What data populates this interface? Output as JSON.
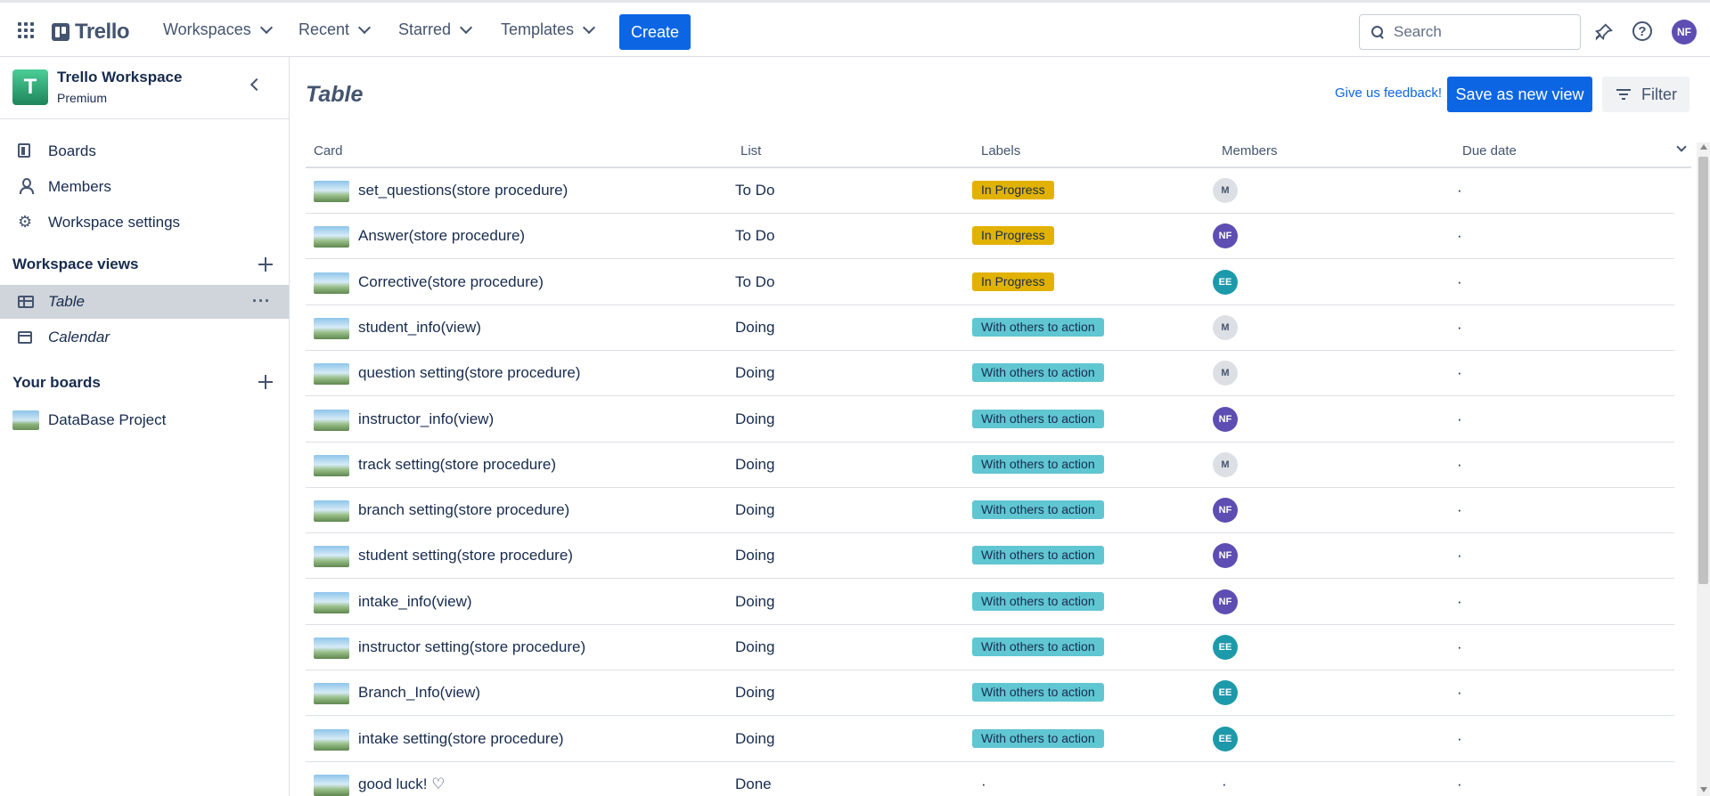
{
  "header": {
    "app_name": "Trello",
    "nav": [
      "Workspaces",
      "Recent",
      "Starred",
      "Templates"
    ],
    "create_label": "Create",
    "search_placeholder": "Search",
    "user_initials": "NF",
    "notification_icon": "notification-icon",
    "help_icon": "help-icon"
  },
  "sidebar": {
    "workspace_initial": "T",
    "workspace_name": "Trello Workspace",
    "workspace_plan": "Premium",
    "items": [
      {
        "label": "Boards",
        "icon": "board-icon"
      },
      {
        "label": "Members",
        "icon": "member-icon"
      },
      {
        "label": "Workspace settings",
        "icon": "gear-icon"
      }
    ],
    "views_title": "Workspace views",
    "views": [
      {
        "label": "Table",
        "icon": "table-icon",
        "active": true
      },
      {
        "label": "Calendar",
        "icon": "calendar-icon",
        "active": false
      }
    ],
    "boards_title": "Your boards",
    "boards": [
      {
        "label": "DataBase Project"
      }
    ]
  },
  "main": {
    "title": "Table",
    "feedback_label": "Give us feedback!",
    "save_label": "Save as new view",
    "filter_label": "Filter",
    "columns": [
      "Card",
      "List",
      "Labels",
      "Members",
      "Due date"
    ],
    "rows": [
      {
        "card": "set_questions(store procedure)",
        "list": "To Do",
        "label": "In Progress",
        "label_color": "#e2b203",
        "member": "M",
        "due": "·"
      },
      {
        "card": "Answer(store procedure)",
        "list": "To Do",
        "label": "In Progress",
        "label_color": "#e2b203",
        "member": "NF",
        "due": "·"
      },
      {
        "card": "Corrective(store procedure)",
        "list": "To Do",
        "label": "In Progress",
        "label_color": "#e2b203",
        "member": "EE",
        "due": "·"
      },
      {
        "card": "student_info(view)",
        "list": "Doing",
        "label": "With others to action",
        "label_color": "#60c6d2",
        "member": "M",
        "due": "·"
      },
      {
        "card": "question setting(store procedure)",
        "list": "Doing",
        "label": "With others to action",
        "label_color": "#60c6d2",
        "member": "M",
        "due": "·"
      },
      {
        "card": "instructor_info(view)",
        "list": "Doing",
        "label": "With others to action",
        "label_color": "#60c6d2",
        "member": "NF",
        "due": "·"
      },
      {
        "card": "track setting(store procedure)",
        "list": "Doing",
        "label": "With others to action",
        "label_color": "#60c6d2",
        "member": "M",
        "due": "·"
      },
      {
        "card": "branch setting(store procedure)",
        "list": "Doing",
        "label": "With others to action",
        "label_color": "#60c6d2",
        "member": "NF",
        "due": "·"
      },
      {
        "card": "student setting(store procedure)",
        "list": "Doing",
        "label": "With others to action",
        "label_color": "#60c6d2",
        "member": "NF",
        "due": "·"
      },
      {
        "card": "intake_info(view)",
        "list": "Doing",
        "label": "With others to action",
        "label_color": "#60c6d2",
        "member": "NF",
        "due": "·"
      },
      {
        "card": "instructor setting(store procedure)",
        "list": "Doing",
        "label": "With others to action",
        "label_color": "#60c6d2",
        "member": "EE",
        "due": "·"
      },
      {
        "card": "Branch_Info(view)",
        "list": "Doing",
        "label": "With others to action",
        "label_color": "#60c6d2",
        "member": "EE",
        "due": "·"
      },
      {
        "card": "intake setting(store procedure)",
        "list": "Doing",
        "label": "With others to action",
        "label_color": "#60c6d2",
        "member": "EE",
        "due": "·"
      },
      {
        "card": "good luck! ♡",
        "list": "Done",
        "label": "·",
        "label_color": "",
        "member": "·",
        "due": "·"
      }
    ]
  }
}
